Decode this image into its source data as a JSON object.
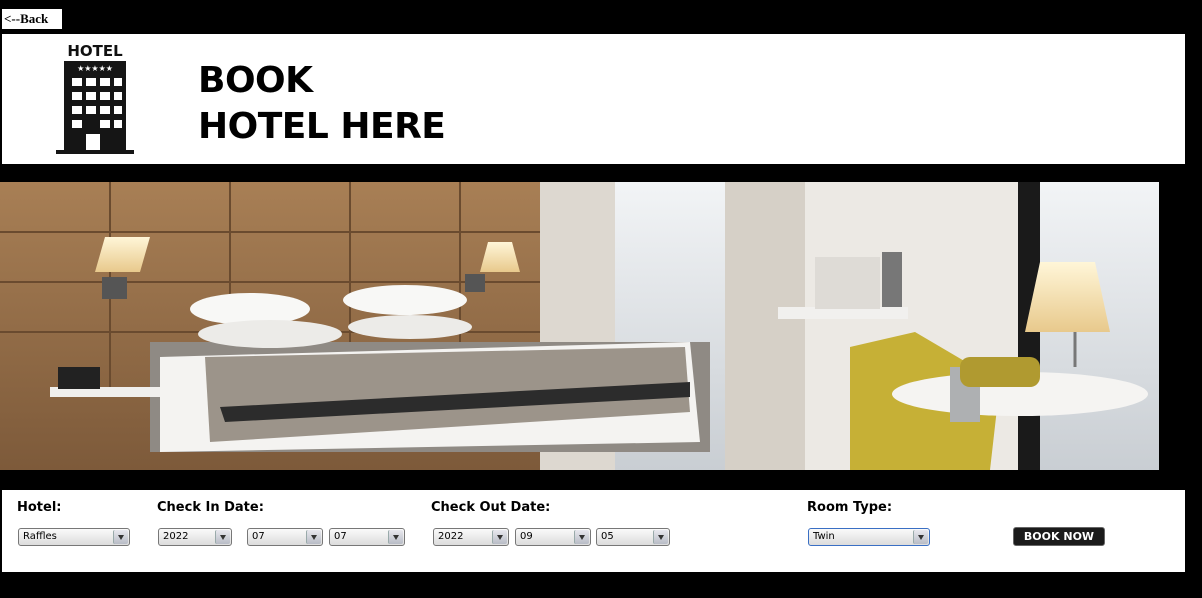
{
  "nav": {
    "back_label": "<--Back"
  },
  "header": {
    "logo_text": "HOTEL",
    "title_line1": "BOOK",
    "title_line2": "HOTEL HERE"
  },
  "form": {
    "hotel": {
      "label": "Hotel:",
      "value": "Raffles"
    },
    "check_in": {
      "label": "Check In Date:",
      "year": "2022",
      "month": "07",
      "day": "07"
    },
    "check_out": {
      "label": "Check Out Date:",
      "year": "2022",
      "month": "09",
      "day": "05"
    },
    "room_type": {
      "label": "Room Type:",
      "value": "Twin"
    },
    "book_label": "BOOK NOW"
  },
  "colors": {
    "background": "#000000",
    "panel": "#ffffff",
    "button": "#1b1b1b",
    "select_focus_border": "#3a6fc4"
  }
}
